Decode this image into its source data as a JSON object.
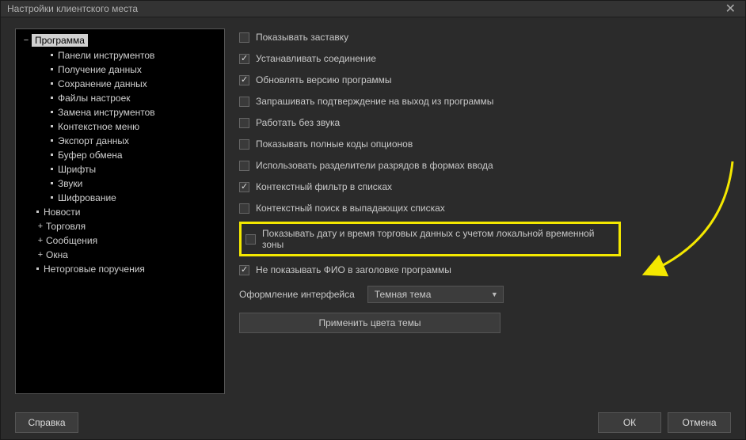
{
  "window": {
    "title": "Настройки клиентского места"
  },
  "tree": {
    "root": {
      "label": "Программа",
      "children": [
        "Панели инструментов",
        "Получение данных",
        "Сохранение данных",
        "Файлы настроек",
        "Замена инструментов",
        "Контекстное меню",
        "Экспорт данных",
        "Буфер обмена",
        "Шрифты",
        "Звуки",
        "Шифрование"
      ]
    },
    "siblings": [
      {
        "label": "Новости",
        "expander": ""
      },
      {
        "label": "Торговля",
        "expander": "+"
      },
      {
        "label": "Сообщения",
        "expander": "+"
      },
      {
        "label": "Окна",
        "expander": "+"
      },
      {
        "label": "Неторговые поручения",
        "expander": ""
      }
    ]
  },
  "options": [
    {
      "label": "Показывать заставку",
      "checked": false
    },
    {
      "label": "Устанавливать соединение",
      "checked": true
    },
    {
      "label": "Обновлять версию программы",
      "checked": true
    },
    {
      "label": "Запрашивать подтверждение на выход из программы",
      "checked": false
    },
    {
      "label": "Работать без звука",
      "checked": false
    },
    {
      "label": "Показывать полные коды опционов",
      "checked": false
    },
    {
      "label": "Использовать разделители разрядов в формах ввода",
      "checked": false
    },
    {
      "label": "Контекстный фильтр в списках",
      "checked": true
    },
    {
      "label": "Контекстный поиск в выпадающих списках",
      "checked": false
    }
  ],
  "highlighted_option": {
    "label": "Показывать дату и время торговых данных с учетом локальной временной зоны",
    "checked": false
  },
  "after_highlight": {
    "label": "Не показывать ФИО в заголовке программы",
    "checked": true
  },
  "theme": {
    "label": "Оформление интерфейса",
    "value": "Темная тема"
  },
  "apply_label": "Применить цвета темы",
  "footer": {
    "help": "Справка",
    "ok": "ОК",
    "cancel": "Отмена"
  }
}
